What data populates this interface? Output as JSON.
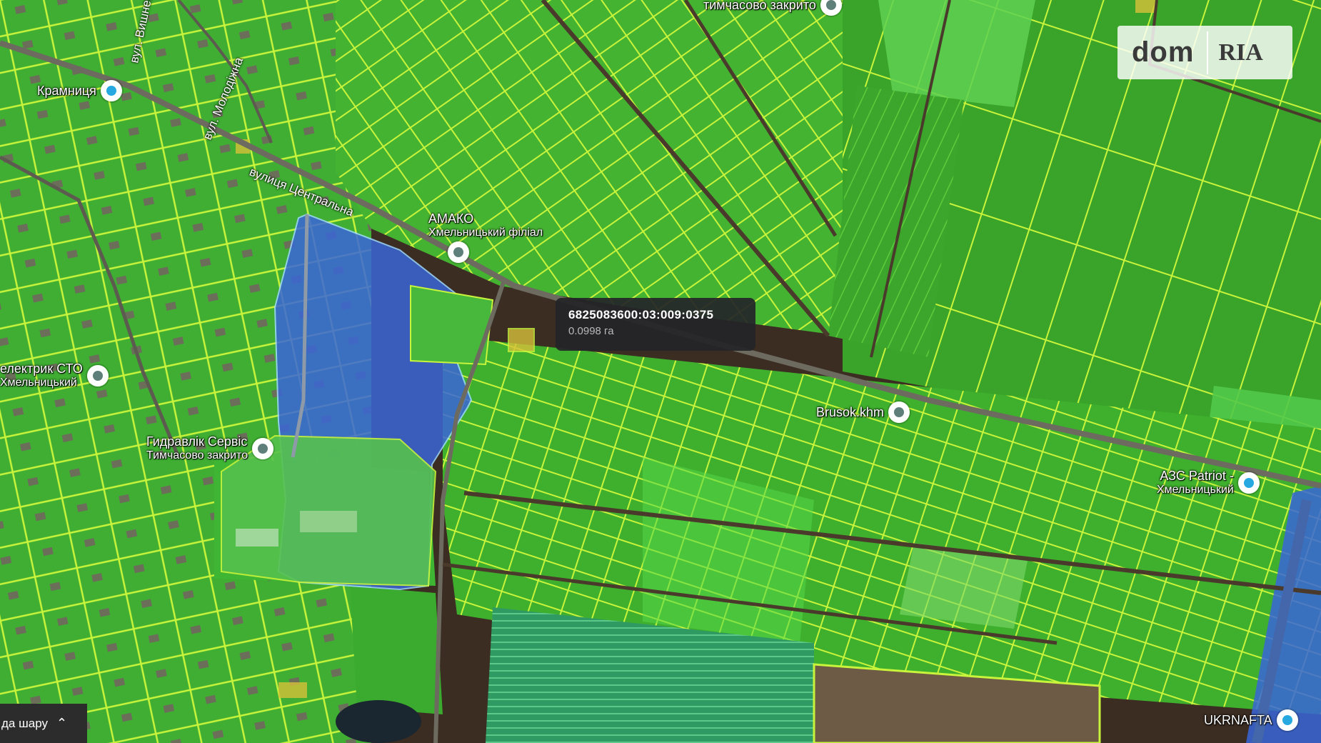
{
  "tooltip": {
    "cadastral_number": "6825083600:03:009:0375",
    "area": "0.0998 га"
  },
  "logo": {
    "part1": "dom",
    "part2": "RIA"
  },
  "layer_button": {
    "label": "да шару",
    "icon": "chevron-up-icon"
  },
  "streets": [
    {
      "id": "vyshneva",
      "label": "вул. Вишнева"
    },
    {
      "id": "molodizhna",
      "label": "вул. Молодіжна"
    },
    {
      "id": "tsentralna",
      "label": "вулиця Центральна"
    }
  ],
  "pois": [
    {
      "id": "kramnytsia",
      "name": "Крамниця",
      "sub": "",
      "pin": "shop-icon"
    },
    {
      "id": "amako",
      "name": "АМАКО",
      "sub": "Хмельницький філіал",
      "pin": "place-icon"
    },
    {
      "id": "sto",
      "name": "електрик СТО",
      "sub": "Хмельницький",
      "pin": "place-icon"
    },
    {
      "id": "hydraulic",
      "name": "Гидравлік Сервіс",
      "sub": "Тимчасово закрито",
      "pin": "place-icon"
    },
    {
      "id": "brusok",
      "name": "Brusok.khm",
      "sub": "",
      "pin": "place-icon"
    },
    {
      "id": "azs",
      "name": "АЗС Patriot -",
      "sub": "Хмельницький",
      "pin": "gas-station-icon"
    },
    {
      "id": "ukrnafta",
      "name": "UKRNAFTA",
      "sub": "",
      "pin": "gas-station-icon"
    },
    {
      "id": "top",
      "name": "тимчасово закрито",
      "sub": "",
      "pin": "place-icon"
    }
  ],
  "colors": {
    "parcel_fill": "#3fbf2f",
    "parcel_stroke": "#b8f23a",
    "selected_blue": "#3a66d8",
    "highlight_yellow": "#e4c23a"
  }
}
